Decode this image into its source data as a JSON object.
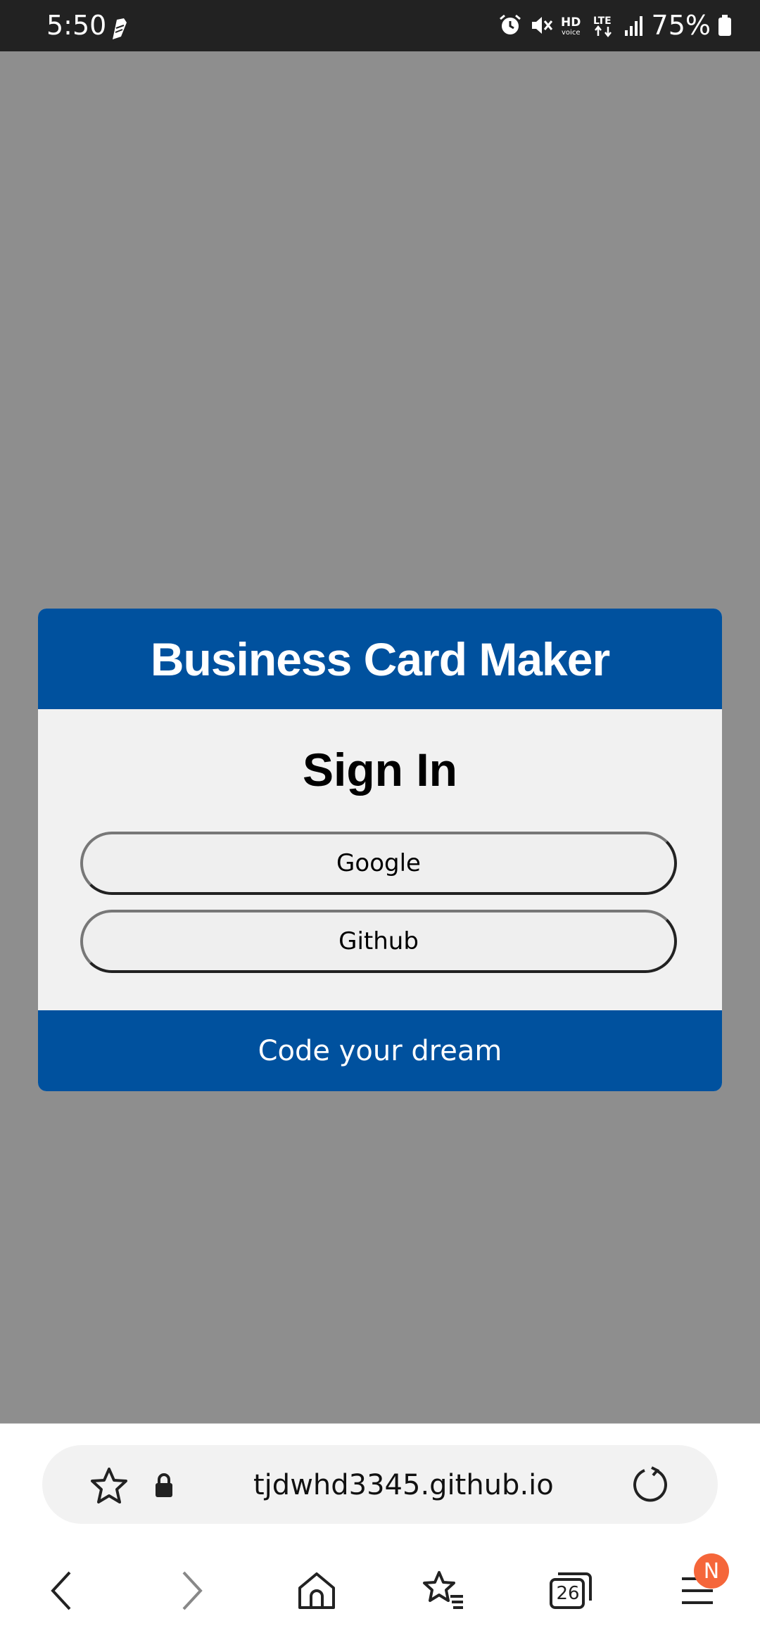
{
  "status_bar": {
    "time": "5:50",
    "battery": "75%",
    "icons": [
      "alarm-icon",
      "mute-icon",
      "hd-voice-icon",
      "lte-icon",
      "signal-icon",
      "battery-icon"
    ]
  },
  "card": {
    "title": "Business Card Maker",
    "heading": "Sign In",
    "buttons": {
      "google": "Google",
      "github": "Github"
    },
    "footer": "Code your dream"
  },
  "browser": {
    "url": "tjdwhd3345.github.io",
    "tabs_count": "26",
    "menu_badge": "N"
  },
  "colors": {
    "brand_blue": "#00519e",
    "backdrop": "#8e8e8e",
    "badge": "#f5663a"
  }
}
